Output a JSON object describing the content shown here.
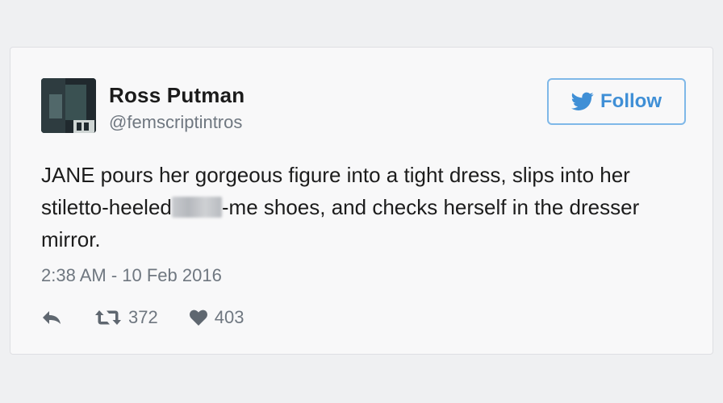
{
  "tweet": {
    "author": {
      "name": "Ross Putman",
      "handle": "@femscriptintros"
    },
    "follow_label": "Follow",
    "text_part1": "JANE pours her gorgeous figure into a tight dress, slips into her stiletto-heeled",
    "text_part2": "-me shoes, and checks herself in the dresser mirror.",
    "timestamp": "2:38 AM - 10 Feb 2016",
    "retweets": "372",
    "likes": "403"
  },
  "colors": {
    "accent": "#3f8fd6",
    "follow_border": "#7fb8e8",
    "muted_text": "#6f7780",
    "main_text": "#1c1c1c"
  },
  "icons": {
    "bird": "twitter-bird-icon",
    "reply": "reply-icon",
    "retweet": "retweet-icon",
    "like": "heart-icon"
  }
}
